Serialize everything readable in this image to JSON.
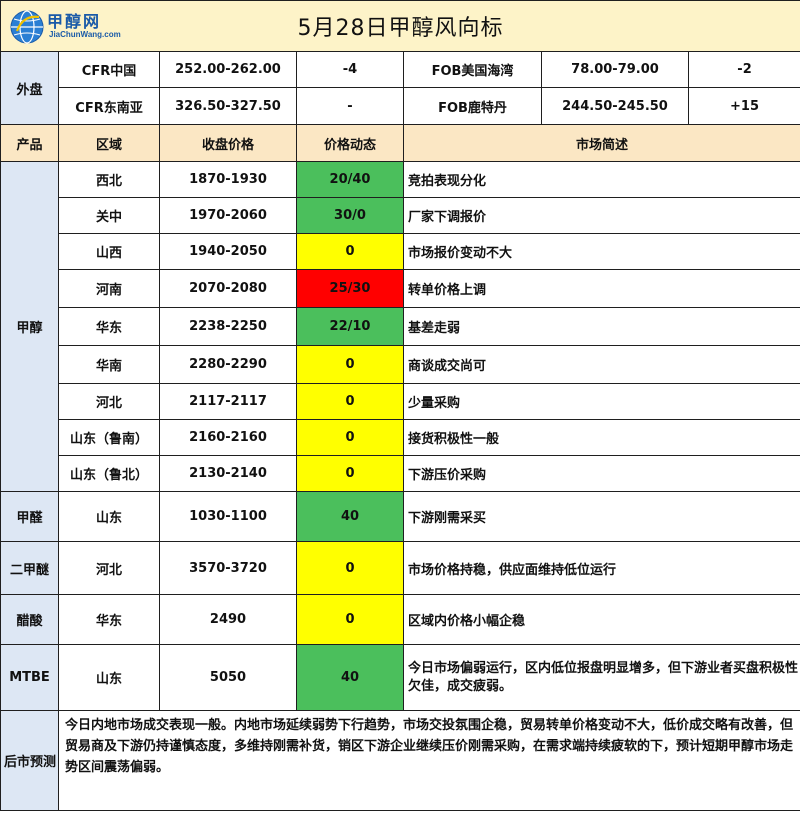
{
  "logo": {
    "cn": "甲醇网",
    "en": "JiaChunWang.com"
  },
  "title": "5月28日甲醇风向标",
  "outer_market": {
    "label": "外盘",
    "rows": [
      {
        "a_name": "CFR中国",
        "a_price": "252.00-262.00",
        "a_change": "-4",
        "b_name": "FOB美国海湾",
        "b_price": "78.00-79.00",
        "b_change": "-2"
      },
      {
        "a_name": "CFR东南亚",
        "a_price": "326.50-327.50",
        "a_change": "-",
        "b_name": "FOB鹿特丹",
        "b_price": "244.50-245.50",
        "b_change": "+15"
      }
    ]
  },
  "headers": {
    "product": "产品",
    "region": "区域",
    "close_price": "收盘价格",
    "price_move": "价格动态",
    "summary": "市场简述"
  },
  "products": [
    {
      "name": "甲醇",
      "rows": [
        {
          "region": "西北",
          "price": "1870-1930",
          "move": "20/40",
          "color": "#4bbf5c",
          "summary": "竞拍表现分化"
        },
        {
          "region": "关中",
          "price": "1970-2060",
          "move": "30/0",
          "color": "#4bbf5c",
          "summary": "厂家下调报价"
        },
        {
          "region": "山西",
          "price": "1940-2050",
          "move": "0",
          "color": "#ffff00",
          "summary": "市场报价变动不大"
        },
        {
          "region": "河南",
          "price": "2070-2080",
          "move": "25/30",
          "color": "#ff0000",
          "summary": "转单价格上调"
        },
        {
          "region": "华东",
          "price": "2238-2250",
          "move": "22/10",
          "color": "#4bbf5c",
          "summary": "基差走弱"
        },
        {
          "region": "华南",
          "price": "2280-2290",
          "move": "0",
          "color": "#ffff00",
          "summary": "商谈成交尚可"
        },
        {
          "region": "河北",
          "price": "2117-2117",
          "move": "0",
          "color": "#ffff00",
          "summary": "少量采购"
        },
        {
          "region": "山东（鲁南）",
          "price": "2160-2160",
          "move": "0",
          "color": "#ffff00",
          "summary": "接货积极性一般"
        },
        {
          "region": "山东（鲁北）",
          "price": "2130-2140",
          "move": "0",
          "color": "#ffff00",
          "summary": "下游压价采购"
        }
      ]
    },
    {
      "name": "甲醛",
      "region": "山东",
      "price": "1030-1100",
      "move": "40",
      "color": "#4bbf5c",
      "summary": "下游刚需采买"
    },
    {
      "name": "二甲醚",
      "region": "河北",
      "price": "3570-3720",
      "move": "0",
      "color": "#ffff00",
      "summary": "市场价格持稳，供应面维持低位运行"
    },
    {
      "name": "醋酸",
      "region": "华东",
      "price": "2490",
      "move": "0",
      "color": "#ffff00",
      "summary": "区域内价格小幅企稳"
    },
    {
      "name": "MTBE",
      "region": "山东",
      "price": "5050",
      "move": "40",
      "color": "#4bbf5c",
      "summary": "今日市场偏弱运行，区内低位报盘明显增多，但下游业者买盘积极性欠佳，成交疲弱。"
    }
  ],
  "forecast": {
    "label": "后市预测",
    "text": "今日内地市场成交表现一般。内地市场延续弱势下行趋势，市场交投氛围企稳，贸易转单价格变动不大，低价成交略有改善，但贸易商及下游仍持谨慎态度，多维持刚需补货，销区下游企业继续压价刚需采购，在需求端持续疲软的下，预计短期甲醇市场走势区间震荡偏弱。"
  }
}
